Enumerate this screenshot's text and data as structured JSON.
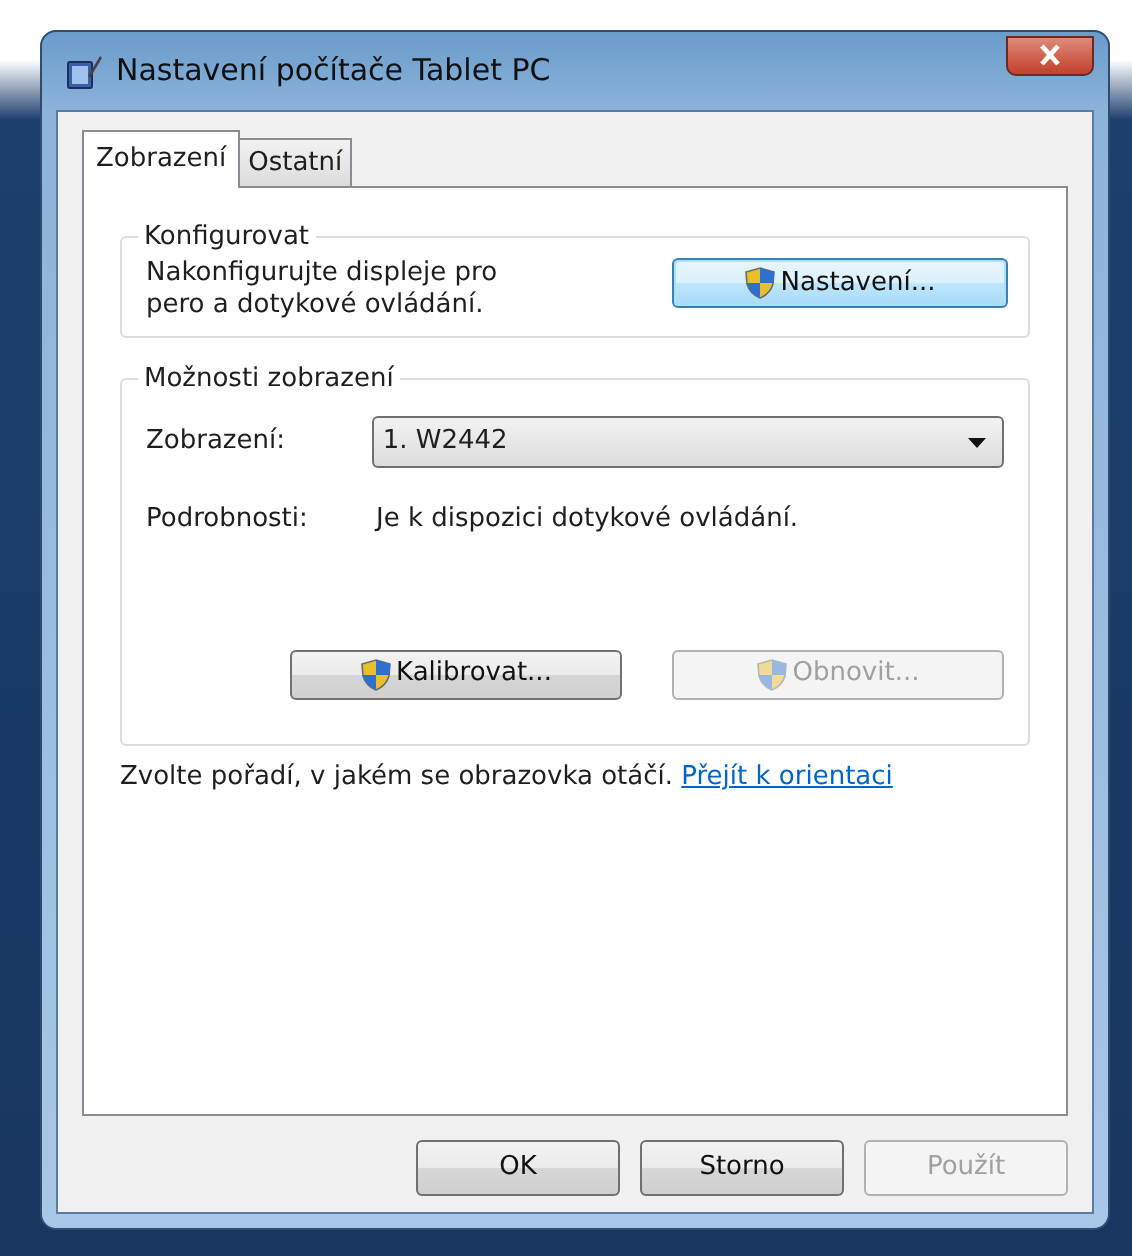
{
  "window": {
    "title": "Nastavení počítače Tablet PC"
  },
  "tabs": [
    {
      "label": "Zobrazení",
      "selected": true
    },
    {
      "label": "Ostatní",
      "selected": false
    }
  ],
  "configure": {
    "legend": "Konfigurovat",
    "text": "Nakonfigurujte displeje pro pero a dotykové ovládání.",
    "button": {
      "label": "Nastavení...",
      "focused": true
    }
  },
  "display_options": {
    "legend": "Možnosti zobrazení",
    "display_label": "Zobrazení:",
    "display_value": "1. W2442",
    "details_label": "Podrobnosti:",
    "details_value": "Je k dispozici dotykové ovládání.",
    "buttons": [
      {
        "label": "Kalibrovat...",
        "disabled": false
      },
      {
        "label": "Obnovit...",
        "disabled": true
      }
    ]
  },
  "footer": {
    "text": "Zvolte pořadí, v jakém se obrazovka otáčí.",
    "link": "Přejít k orientaci"
  },
  "dialog_buttons": [
    {
      "label": "OK",
      "disabled": false
    },
    {
      "label": "Storno",
      "disabled": false
    },
    {
      "label": "Použít",
      "disabled": true
    }
  ]
}
